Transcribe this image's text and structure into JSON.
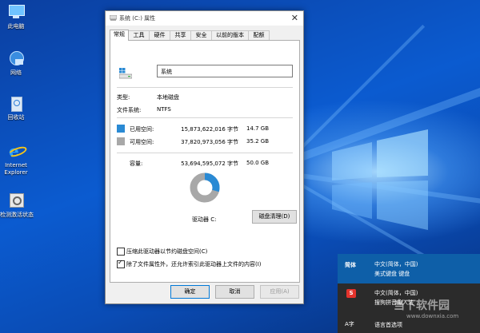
{
  "desktop": {
    "icons": [
      {
        "label": "此电脑",
        "icon": "computer-icon"
      },
      {
        "label": "网络",
        "icon": "network-icon"
      },
      {
        "label": "回收站",
        "icon": "recycle-bin-icon"
      },
      {
        "label": "Internet Explorer",
        "icon": "ie-icon"
      },
      {
        "label": "检测激活状态",
        "icon": "activation-icon"
      }
    ]
  },
  "window": {
    "title": "系统 (C:) 属性",
    "tabs": [
      "常规",
      "工具",
      "硬件",
      "共享",
      "安全",
      "以前的版本",
      "配额"
    ],
    "active_tab": 0,
    "drive_name": "系统",
    "type_label": "类型:",
    "type_value": "本地磁盘",
    "fs_label": "文件系统:",
    "fs_value": "NTFS",
    "used_label": "已用空间:",
    "used_bytes": "15,873,622,016 字节",
    "used_size": "14.7 GB",
    "free_label": "可用空间:",
    "free_bytes": "37,820,973,056 字节",
    "free_size": "35.2 GB",
    "cap_label": "容量:",
    "cap_bytes": "53,694,595,072 字节",
    "cap_size": "50.0 GB",
    "used_fraction": 0.296,
    "drive_label": "驱动器 C:",
    "cleanup_button": "磁盘清理(D)",
    "compress_label": "压缩此驱动器以节约磁盘空间(C)",
    "compress_checked": false,
    "index_label": "除了文件属性外，还允许索引此驱动器上文件的内容(I)",
    "index_checked": true,
    "ok_button": "确定",
    "cancel_button": "取消",
    "apply_button": "应用(A)",
    "colors": {
      "used": "#2a8ad4",
      "free": "#a8a8a8"
    }
  },
  "ime_popup": {
    "items": [
      {
        "key": "简体",
        "line1": "中文(简体，中国)",
        "line2": "美式键盘 键盘",
        "selected": true
      },
      {
        "key": "S",
        "line1": "中文(简体，中国)",
        "line2": "搜狗拼音输入法",
        "selected": false
      }
    ],
    "pref_icon_text": "A字",
    "pref_label": "语言首选项"
  },
  "watermark": {
    "main": "当下软件园",
    "sub": "www.downxia.com"
  }
}
